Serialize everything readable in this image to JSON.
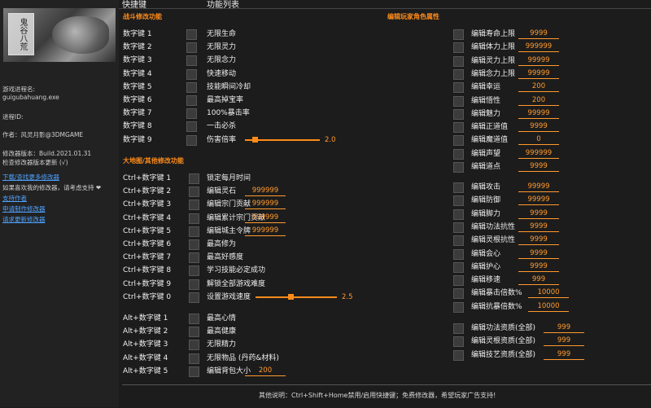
{
  "header": {
    "hotkey": "快捷键",
    "features": "功能列表"
  },
  "sidebar": {
    "process_name_label": "游戏进程名:",
    "process_name": "guigubahuang.exe",
    "process_id_label": "进程ID:",
    "author": "作者：风灵月影@3DMGAME",
    "version": "修改器版本：Build.2021.01.31",
    "check_update": "检查修改器版本更新 (√)",
    "links": [
      "下载/查找更多修改器",
      "支持作者",
      "申请制作修改器",
      "请求更新修改器"
    ],
    "support_text": "如果喜欢我的修改器，请考虑支持 ❤"
  },
  "combat": {
    "title": "战斗修改功能",
    "rows": [
      {
        "key": "数字键 1",
        "label": "无限生命"
      },
      {
        "key": "数字键 2",
        "label": "无限灵力"
      },
      {
        "key": "数字键 3",
        "label": "无限念力"
      },
      {
        "key": "数字键 4",
        "label": "快速移动"
      },
      {
        "key": "数字键 5",
        "label": "技能瞬间冷却"
      },
      {
        "key": "数字键 6",
        "label": "最高掉宝率"
      },
      {
        "key": "数字键 7",
        "label": "100%暴击率"
      },
      {
        "key": "数字键 8",
        "label": "一击必杀"
      },
      {
        "key": "数字键 9",
        "label": "伤害倍率",
        "slider": "2.0",
        "level": 0.1
      }
    ]
  },
  "world": {
    "title": "大地图/其他修改功能",
    "rows": [
      {
        "key": "Ctrl+数字键 1",
        "label": "锁定每月时间"
      },
      {
        "key": "Ctrl+数字键 2",
        "label": "编辑灵石",
        "value": "999999"
      },
      {
        "key": "Ctrl+数字键 3",
        "label": "编辑宗门贡献",
        "value": "999999"
      },
      {
        "key": "Ctrl+数字键 4",
        "label": "编辑累计宗门贡献",
        "value": "999999"
      },
      {
        "key": "Ctrl+数字键 5",
        "label": "编辑城主令牌",
        "value": "999999"
      },
      {
        "key": "Ctrl+数字键 6",
        "label": "最高修为"
      },
      {
        "key": "Ctrl+数字键 7",
        "label": "最高好感度"
      },
      {
        "key": "Ctrl+数字键 8",
        "label": "学习技能必定成功"
      },
      {
        "key": "Ctrl+数字键 9",
        "label": "解锁全部游戏难度"
      },
      {
        "key": "Ctrl+数字键 0",
        "label": "设置游戏速度",
        "slider": "2.5",
        "level": 0.4
      }
    ]
  },
  "alt": {
    "rows": [
      {
        "key": "Alt+数字键 1",
        "label": "最高心情"
      },
      {
        "key": "Alt+数字键 2",
        "label": "最高健康"
      },
      {
        "key": "Alt+数字键 3",
        "label": "无限精力"
      },
      {
        "key": "Alt+数字键 4",
        "label": "无限物品 (丹药&材料)"
      },
      {
        "key": "Alt+数字键 5",
        "label": "编辑背包大小",
        "value": "200"
      }
    ]
  },
  "player": {
    "title": "编辑玩家角色属性",
    "rows": [
      {
        "label": "编辑寿命上限",
        "value": "9999"
      },
      {
        "label": "编辑体力上限",
        "value": "999999"
      },
      {
        "label": "编辑灵力上限",
        "value": "99999"
      },
      {
        "label": "编辑念力上限",
        "value": "99999"
      },
      {
        "label": "编辑幸运",
        "value": "200"
      },
      {
        "label": "编辑悟性",
        "value": "200"
      },
      {
        "label": "编辑魅力",
        "value": "99999"
      },
      {
        "label": "编辑正道值",
        "value": "9999"
      },
      {
        "label": "编辑魔道值",
        "value": "0"
      },
      {
        "label": "编辑声望",
        "value": "999999"
      },
      {
        "label": "编辑道点",
        "value": "9999"
      },
      {
        "label": "编辑攻击",
        "value": "99999"
      },
      {
        "label": "编辑防御",
        "value": "99999"
      },
      {
        "label": "编辑脚力",
        "value": "9999"
      },
      {
        "label": "编辑功法抗性",
        "value": "9999"
      },
      {
        "label": "编辑灵根抗性",
        "value": "9999"
      },
      {
        "label": "编辑会心",
        "value": "9999"
      },
      {
        "label": "编辑护心",
        "value": "9999"
      },
      {
        "label": "编辑移速",
        "value": "999"
      },
      {
        "label": "编辑暴击倍数%",
        "value": "10000"
      },
      {
        "label": "编辑抗暴倍数%",
        "value": "10000"
      },
      {
        "label": "编辑功法资质(全部)",
        "value": "999"
      },
      {
        "label": "编辑灵根资质(全部)",
        "value": "999"
      },
      {
        "label": "编辑技艺资质(全部)",
        "value": "999"
      }
    ]
  },
  "footer": {
    "note": "其他说明：Ctrl+Shift+Home禁用/启用快捷键；免费修改器，希望玩家广告支持!"
  }
}
